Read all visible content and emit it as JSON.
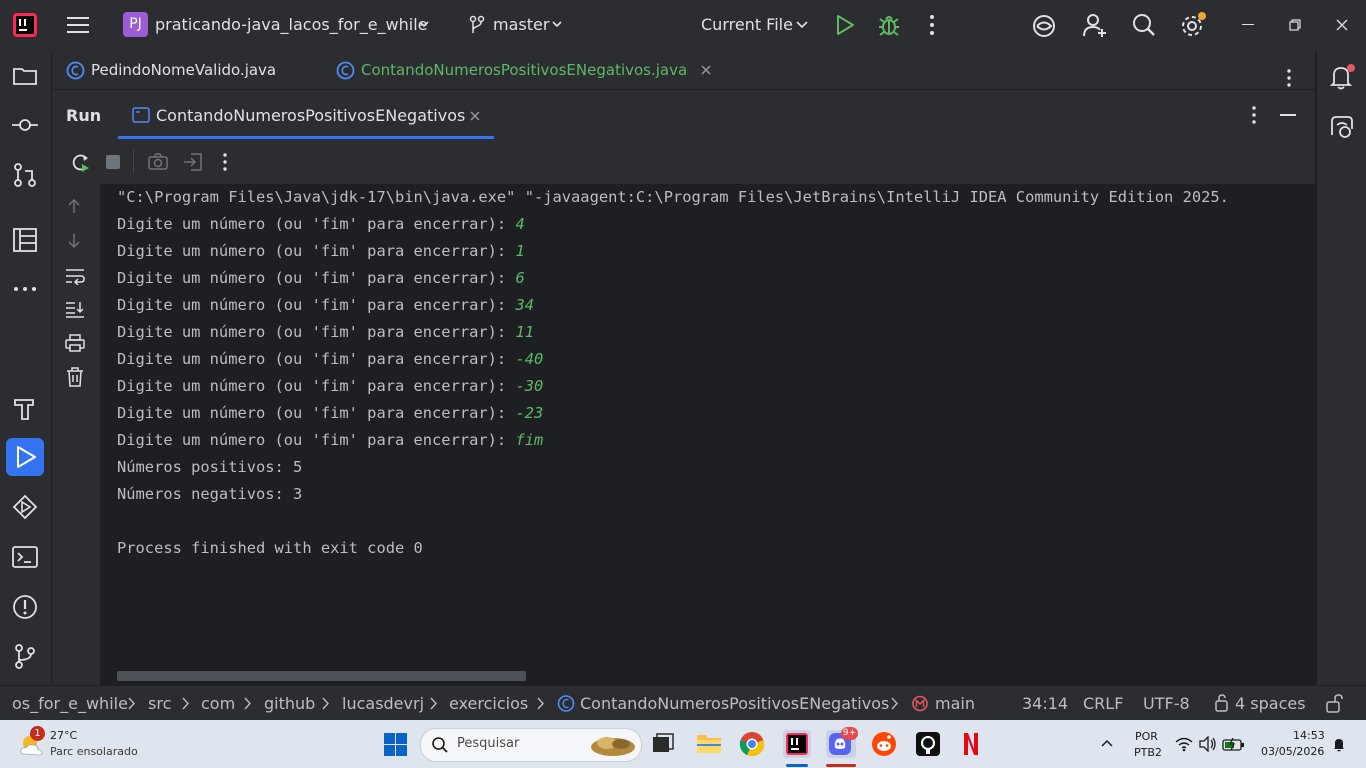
{
  "titlebar": {
    "project_badge": "PJ",
    "project_name": "praticando-java_lacos_for_e_while",
    "branch": "master",
    "run_config": "Current File"
  },
  "editor_tabs": [
    {
      "label": "PedindoNomeValido.java"
    },
    {
      "label": "ContandoNumerosPositivosENegativos.java"
    }
  ],
  "run_panel": {
    "title": "Run",
    "tab_label": "ContandoNumerosPositivosENegativos"
  },
  "console": {
    "command": "\"C:\\Program Files\\Java\\jdk-17\\bin\\java.exe\" \"-javaagent:C:\\Program Files\\JetBrains\\IntelliJ IDEA Community Edition 2025.",
    "prompt": "Digite um número (ou 'fim' para encerrar): ",
    "inputs": [
      "4",
      "1",
      "6",
      "34",
      "11",
      "-40",
      "-30",
      "-23",
      "fim"
    ],
    "positives": "Números positivos: 5",
    "negatives": "Números negativos: 3",
    "exit": "Process finished with exit code 0"
  },
  "statusbar": {
    "breadcrumbs": [
      "os_for_e_while",
      "src",
      "com",
      "github",
      "lucasdevrj",
      "exercicios",
      "ContandoNumerosPositivosENegativos",
      "main"
    ],
    "position": "34:14",
    "line_sep": "CRLF",
    "encoding": "UTF-8",
    "indent": "4 spaces"
  },
  "taskbar": {
    "weather_badge": "1",
    "temperature": "27°C",
    "weather_desc": "Parc ensolarado",
    "search_placeholder": "Pesquisar",
    "discord_badge": "9+",
    "lang_top": "POR",
    "lang_bottom": "PTB2",
    "time": "14:53",
    "date": "03/05/2026"
  },
  "colors": {
    "accent": "#3574f0",
    "input_green": "#5fb865",
    "run_green": "#5fb865",
    "panel_bg": "#2b2d30",
    "console_bg": "#1e1f22"
  }
}
